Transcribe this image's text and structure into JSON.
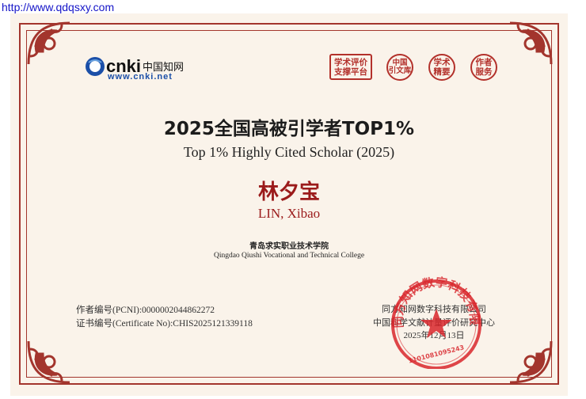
{
  "url_bar": {
    "text": "http://www.qdqsxy.com"
  },
  "logo": {
    "brand": "cnki",
    "cn": "中国知网",
    "url": "www.cnki.net"
  },
  "badges": [
    {
      "line1": "学术评价",
      "line2": "支撑平台"
    },
    {
      "line1": "中国",
      "line2": "引文库"
    },
    {
      "line1": "学术",
      "line2": "精要"
    },
    {
      "line1": "作者",
      "line2": "服务"
    }
  ],
  "certificate": {
    "title_cn": "2025全国高被引学者TOP1%",
    "title_en": "Top 1% Highly Cited Scholar (2025)",
    "name_cn": "林夕宝",
    "name_en": "LIN, Xibao",
    "institution_cn": "青岛求实职业技术学院",
    "institution_en": "Qingdao Qiushi Vocational and Technical College",
    "pcni_line": "作者编号(PCNI):0000002044862272",
    "cert_line": "证书编号(Certificate No):CHIS2025121339118",
    "issuer_1": "同方知网数字科技有限公司",
    "issuer_2": "中国科学文献计量评价研究中心",
    "date": "2025年12月13日"
  },
  "seal": {
    "arc_text": "同方知网数字科技有限公司",
    "number": "1101081095243"
  },
  "colors": {
    "border": "#a3352d",
    "accent": "#9b1b1b",
    "seal": "#d8262c",
    "paper": "#faf3ea"
  }
}
